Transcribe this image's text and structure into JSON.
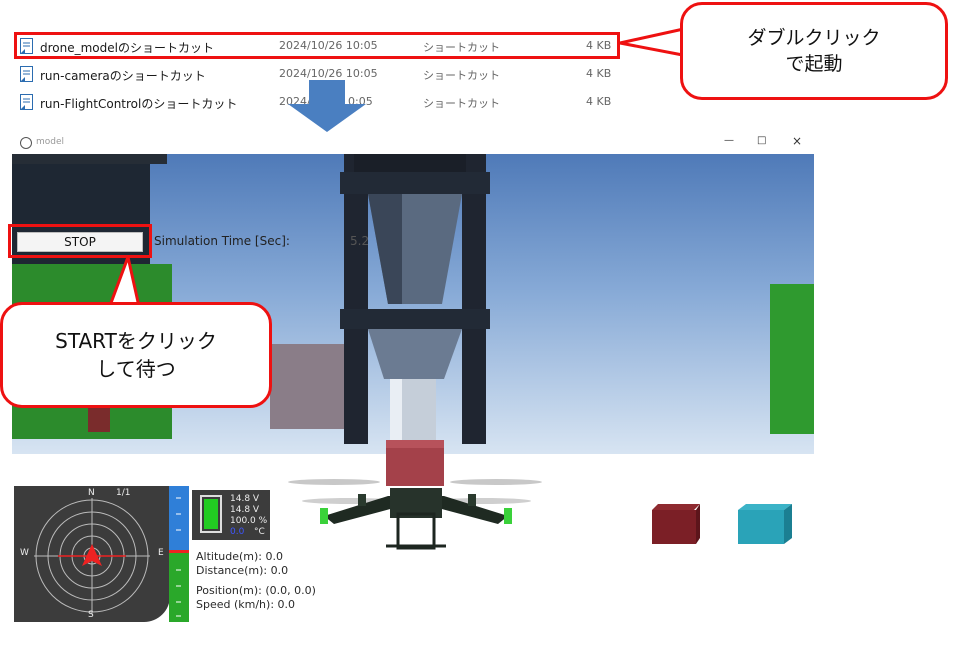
{
  "explorer": {
    "files": [
      {
        "name": "drone_modelのショートカット",
        "date": "2024/10/26 10:05",
        "type": "ショートカット",
        "size": "4 KB"
      },
      {
        "name": "run-cameraのショートカット",
        "date": "2024/10/26 10:05",
        "type": "ショートカット",
        "size": "4 KB"
      },
      {
        "name": "run-FlightControlのショートカット",
        "date": "2024/",
        "date_tail": "0:05",
        "type": "ショートカット",
        "size": "4 KB"
      }
    ]
  },
  "callouts": {
    "double_click_line1": "ダブルクリック",
    "double_click_line2": "で起動",
    "start_line1": "STARTをクリック",
    "start_line2": "して待つ"
  },
  "game_window": {
    "title": "model",
    "controls": {
      "minimize": "—",
      "maximize": "□",
      "close": "×"
    },
    "stop_button": "STOP",
    "sim_time_label": "Simulation Time [Sec]:",
    "sim_time_value": "5.2"
  },
  "hud": {
    "compass": {
      "n": "N",
      "s": "S",
      "w": "W",
      "e": "E",
      "page": "1/1"
    },
    "battery": {
      "v1": "14.8  V",
      "v2": "14.8  V",
      "pct": "100.0 %",
      "temp_val": "0.0",
      "temp_unit": "°C",
      "level": 1.0
    },
    "telemetry": {
      "altitude": "Altitude(m): 0.0",
      "distance": "Distance(m): 0.0",
      "position": "Position(m): (0.0, 0.0)",
      "speed": "Speed (km/h): 0.0"
    }
  },
  "colors": {
    "callout_red": "#e11111",
    "arrow_blue": "#4a7fc1"
  }
}
